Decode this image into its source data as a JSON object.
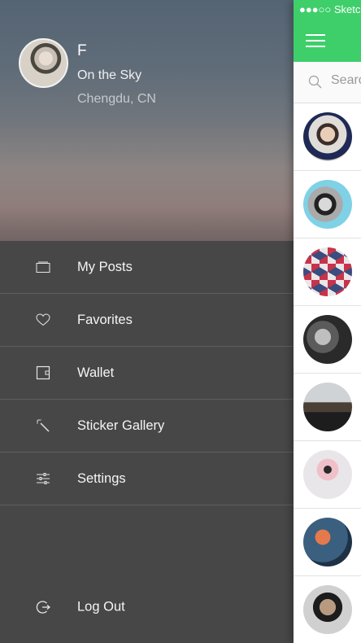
{
  "profile": {
    "name": "F",
    "status": "On the Sky",
    "location": "Chengdu, CN"
  },
  "menu": [
    {
      "label": "My Posts",
      "icon": "posts-icon"
    },
    {
      "label": "Favorites",
      "icon": "heart-icon"
    },
    {
      "label": "Wallet",
      "icon": "wallet-icon"
    },
    {
      "label": "Sticker Gallery",
      "icon": "magic-wand-icon"
    },
    {
      "label": "Settings",
      "icon": "sliders-icon"
    }
  ],
  "logout": {
    "label": "Log Out",
    "icon": "logout-icon"
  },
  "main": {
    "status_text": "●●●○○ Sketc",
    "search_placeholder": "Search"
  },
  "colors": {
    "accent": "#3ecf6a",
    "drawer_bg": "#474747",
    "divider": "#5e5e5e"
  }
}
